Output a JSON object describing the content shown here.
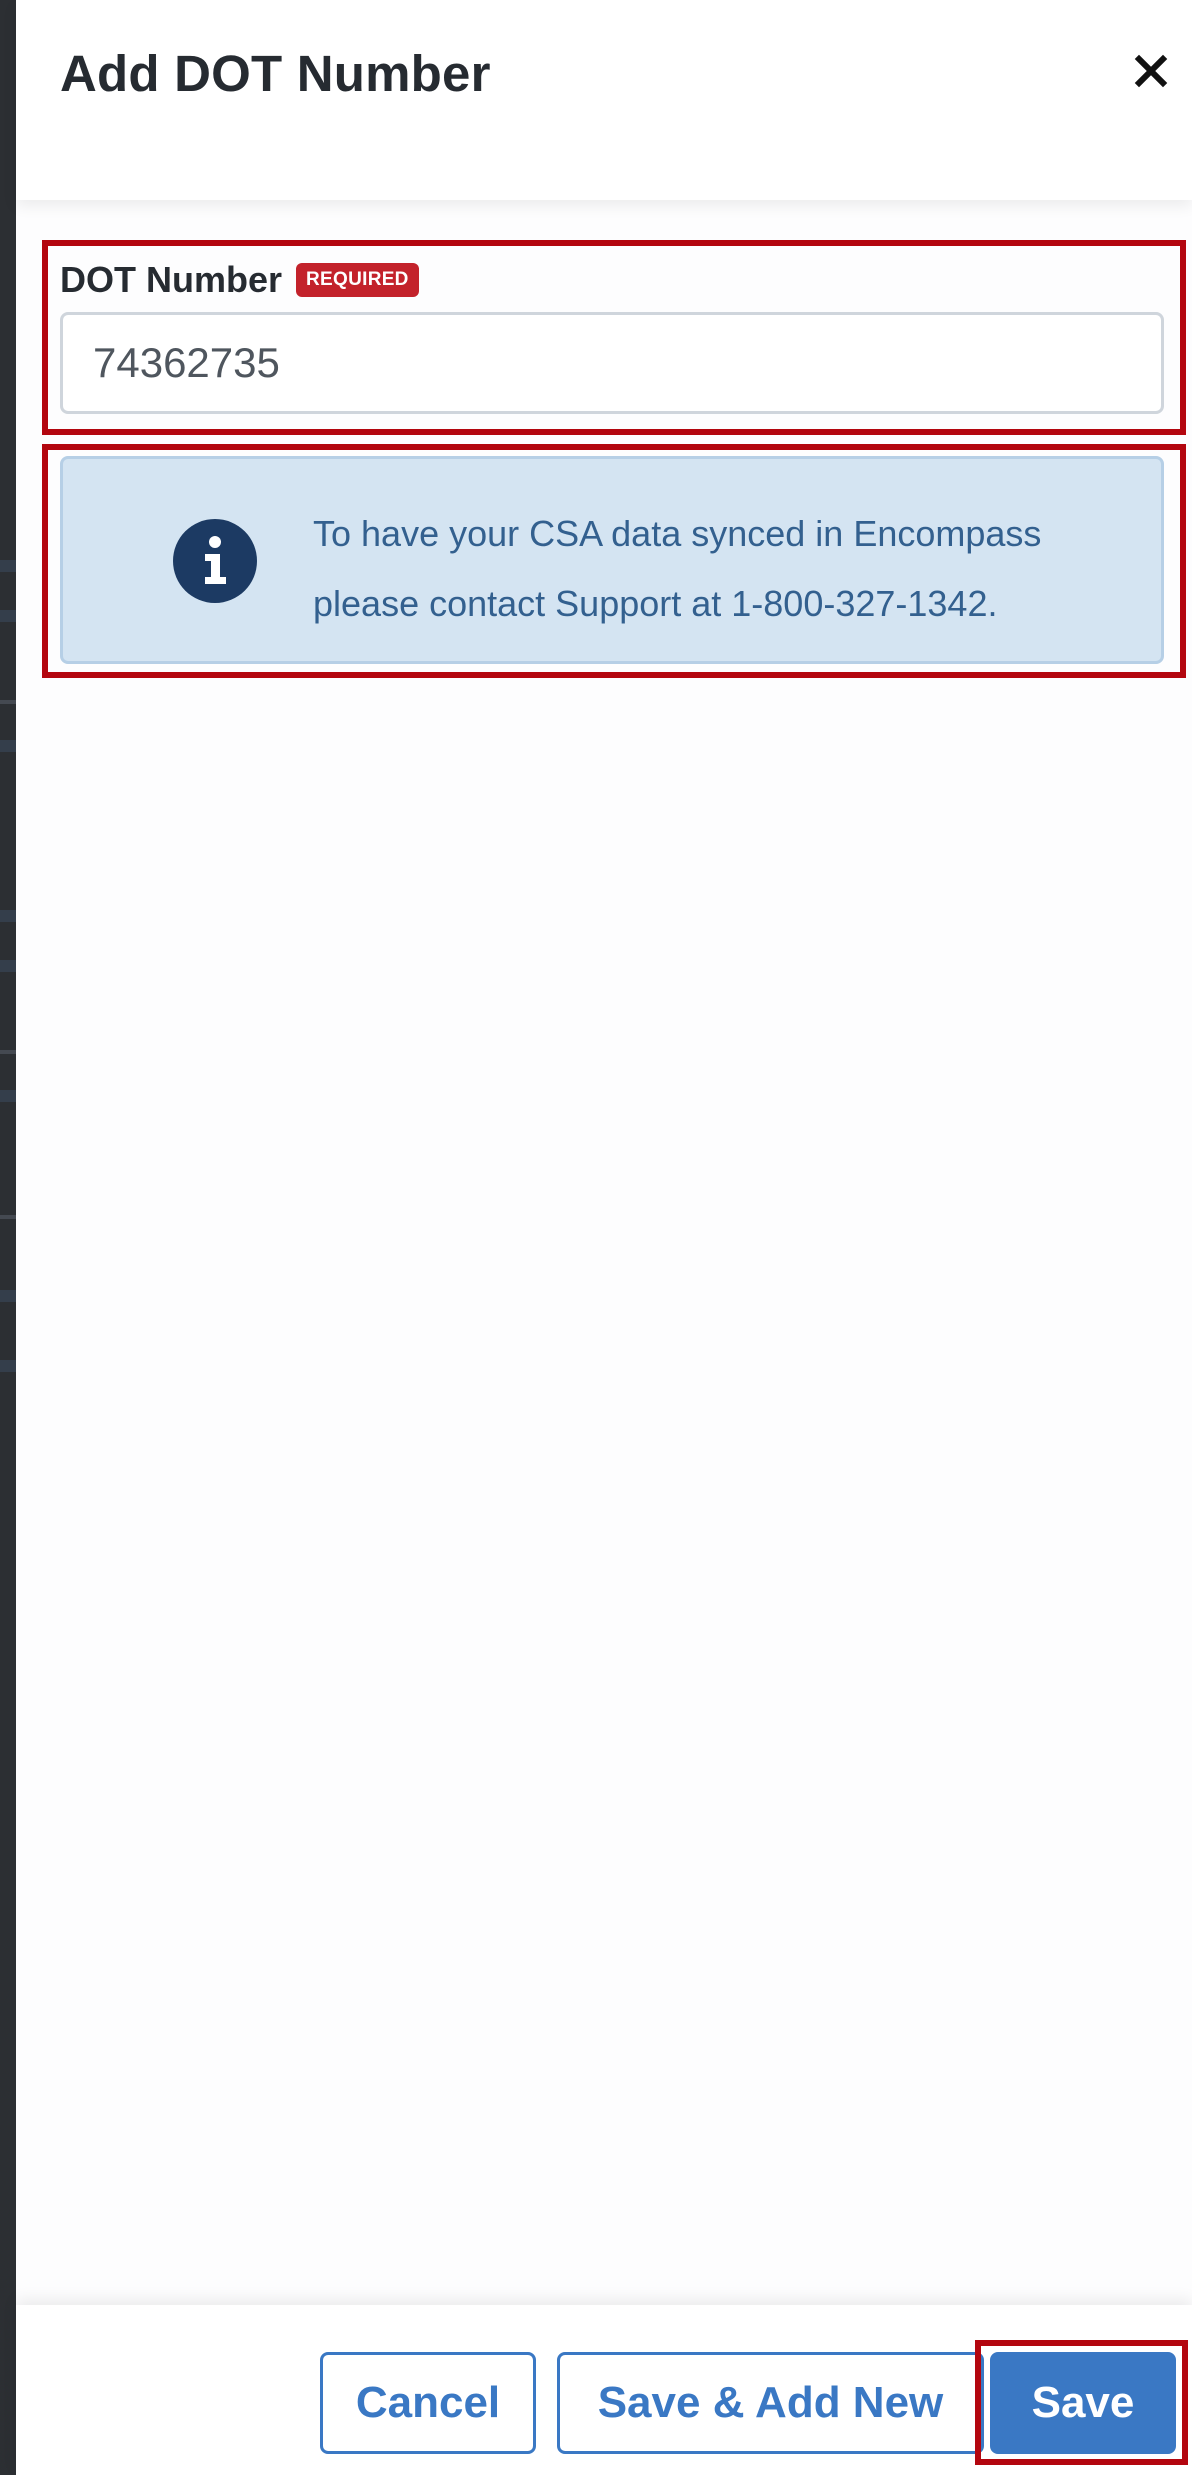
{
  "drawer": {
    "title": "Add DOT Number",
    "close_icon": "close-icon"
  },
  "form": {
    "dot_number": {
      "label": "DOT Number",
      "badge": "REQUIRED",
      "value": "74362735"
    }
  },
  "info_banner": {
    "icon": "info-circle-icon",
    "line1": "To have your CSA data synced in Encompass",
    "line2": "please contact Support at 1-800-327-1342."
  },
  "footer": {
    "cancel_label": "Cancel",
    "save_add_new_label": "Save & Add New",
    "save_label": "Save"
  },
  "colors": {
    "primary": "#3a78c4",
    "required_badge": "#c3222b",
    "info_background": "#d4e4f2",
    "info_text": "#33608f",
    "annotation": "#b3060f"
  }
}
